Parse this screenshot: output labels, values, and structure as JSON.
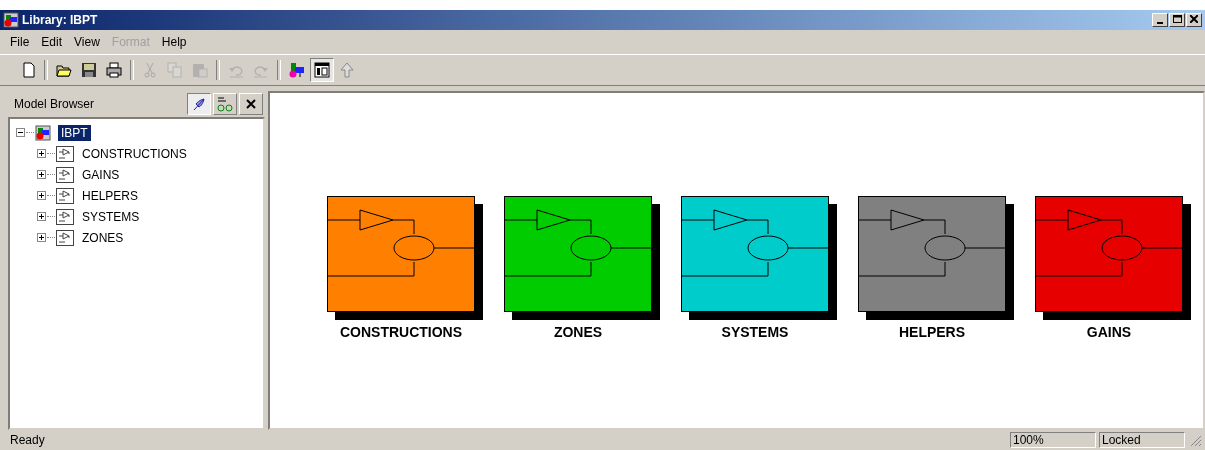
{
  "window": {
    "title": "Library: IBPT"
  },
  "menu": [
    {
      "label": "File",
      "disabled": false
    },
    {
      "label": "Edit",
      "disabled": false
    },
    {
      "label": "View",
      "disabled": false
    },
    {
      "label": "Format",
      "disabled": true
    },
    {
      "label": "Help",
      "disabled": false
    }
  ],
  "toolbar": [
    {
      "kind": "new",
      "disabled": false,
      "pressed": false
    },
    {
      "kind": "separator"
    },
    {
      "kind": "open",
      "disabled": false,
      "pressed": false
    },
    {
      "kind": "save",
      "disabled": false,
      "pressed": false
    },
    {
      "kind": "print",
      "disabled": false,
      "pressed": false
    },
    {
      "kind": "separator"
    },
    {
      "kind": "cut",
      "disabled": true,
      "pressed": false
    },
    {
      "kind": "copy",
      "disabled": true,
      "pressed": false
    },
    {
      "kind": "paste",
      "disabled": true,
      "pressed": false
    },
    {
      "kind": "separator"
    },
    {
      "kind": "undo",
      "disabled": true,
      "pressed": false
    },
    {
      "kind": "redo",
      "disabled": true,
      "pressed": false
    },
    {
      "kind": "separator"
    },
    {
      "kind": "library",
      "disabled": false,
      "pressed": false
    },
    {
      "kind": "browser",
      "disabled": false,
      "pressed": true
    },
    {
      "kind": "up",
      "disabled": false,
      "pressed": false
    }
  ],
  "sidebar": {
    "title": "Model Browser",
    "tree": [
      {
        "label": "IBPT",
        "selected": true,
        "expanded": true,
        "children": [
          {
            "label": "CONSTRUCTIONS",
            "selected": false,
            "expanded": false
          },
          {
            "label": "GAINS",
            "selected": false,
            "expanded": false
          },
          {
            "label": "HELPERS",
            "selected": false,
            "expanded": false
          },
          {
            "label": "SYSTEMS",
            "selected": false,
            "expanded": false
          },
          {
            "label": "ZONES",
            "selected": false,
            "expanded": false
          }
        ]
      }
    ]
  },
  "blocks": [
    {
      "label": "CONSTRUCTIONS",
      "color": "#ff8000"
    },
    {
      "label": "ZONES",
      "color": "#00cc00"
    },
    {
      "label": "SYSTEMS",
      "color": "#00cccc"
    },
    {
      "label": "HELPERS",
      "color": "#808080"
    },
    {
      "label": "GAINS",
      "color": "#e60000"
    }
  ],
  "status_bar": {
    "message": "Ready",
    "zoom": "100%",
    "lock": "Locked"
  }
}
